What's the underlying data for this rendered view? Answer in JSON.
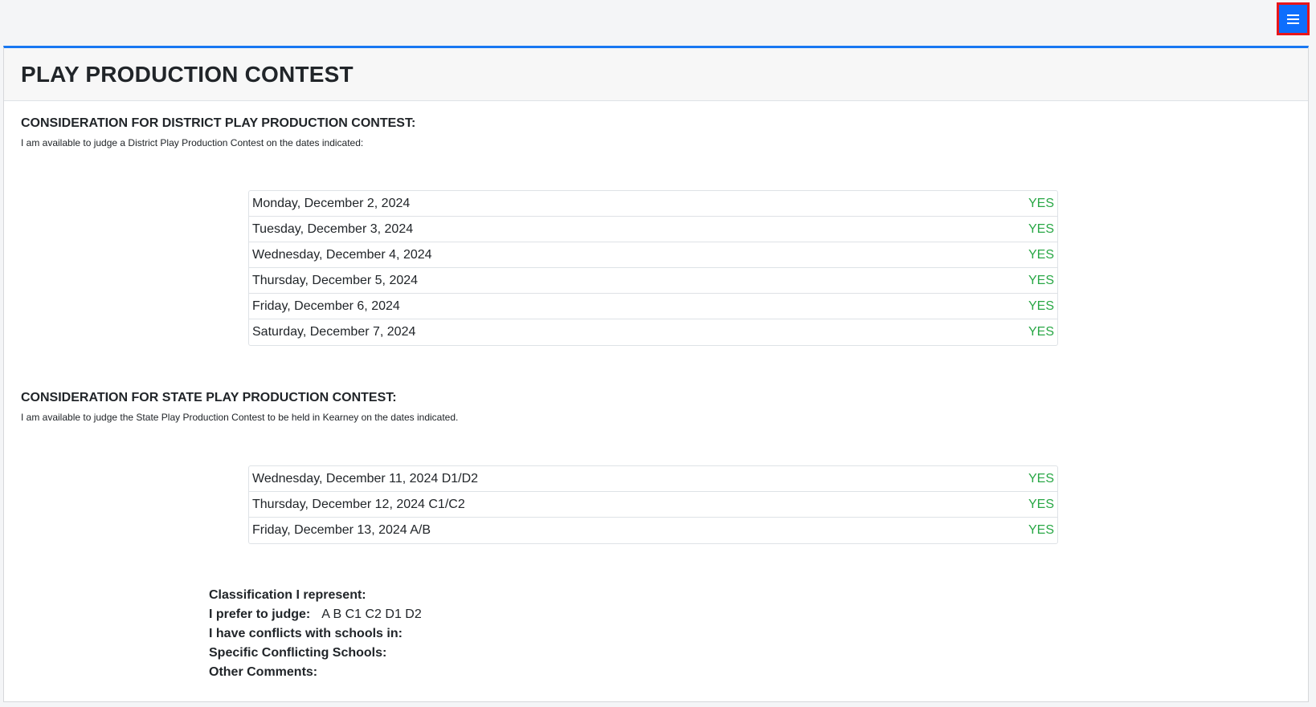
{
  "page": {
    "title": "PLAY PRODUCTION CONTEST",
    "menu_icon": "hamburger-menu-icon",
    "accent_color": "#1877f2",
    "yes_color": "#28a745"
  },
  "district": {
    "heading": "CONSIDERATION FOR DISTRICT PLAY PRODUCTION CONTEST:",
    "description": "I am available to judge a District Play Production Contest on the dates indicated:",
    "rows": [
      {
        "date": "Monday, December 2, 2024",
        "answer": "YES"
      },
      {
        "date": "Tuesday, December 3, 2024",
        "answer": "YES"
      },
      {
        "date": "Wednesday, December 4, 2024",
        "answer": "YES"
      },
      {
        "date": "Thursday, December 5, 2024",
        "answer": "YES"
      },
      {
        "date": "Friday, December 6, 2024",
        "answer": "YES"
      },
      {
        "date": "Saturday, December 7, 2024",
        "answer": "YES"
      }
    ]
  },
  "state": {
    "heading": "CONSIDERATION FOR STATE PLAY PRODUCTION CONTEST:",
    "description": "I am available to judge the State Play Production Contest to be held in Kearney on the dates indicated.",
    "rows": [
      {
        "date": "Wednesday, December 11, 2024 D1/D2",
        "answer": "YES"
      },
      {
        "date": "Thursday, December 12, 2024 C1/C2",
        "answer": "YES"
      },
      {
        "date": "Friday, December 13, 2024 A/B",
        "answer": "YES"
      }
    ]
  },
  "preferences": {
    "classification_label": "Classification I represent:",
    "classification_value": "",
    "prefer_label": "I prefer to judge:",
    "prefer_value": "A B C1 C2 D1 D2",
    "conflicts_label": "I have conflicts with schools in:",
    "conflicts_value": "",
    "specific_label": "Specific Conflicting Schools:",
    "specific_value": "",
    "comments_label": "Other Comments:",
    "comments_value": ""
  }
}
